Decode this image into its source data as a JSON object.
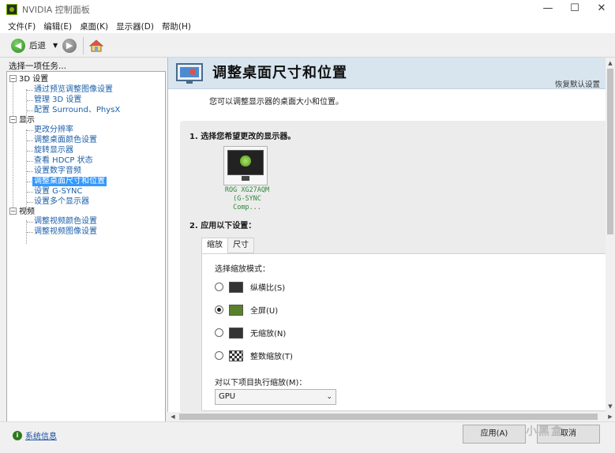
{
  "window": {
    "title": "NVIDIA 控制面板",
    "minimize": "—",
    "maximize": "☐",
    "close": "✕"
  },
  "menu": [
    "文件(F)",
    "编辑(E)",
    "桌面(K)",
    "显示器(D)",
    "帮助(H)"
  ],
  "toolbar": {
    "back_label": "后退",
    "back_glyph": "◀",
    "forward_glyph": "▶",
    "dropdown_glyph": "▼"
  },
  "sidebar": {
    "heading": "选择一项任务...",
    "categories": [
      {
        "label": "3D 设置",
        "expander": "−",
        "items": [
          "通过预览调整图像设置",
          "管理 3D 设置",
          "配置 Surround、PhysX"
        ]
      },
      {
        "label": "显示",
        "expander": "−",
        "items": [
          "更改分辨率",
          "调整桌面颜色设置",
          "旋转显示器",
          "查看 HDCP 状态",
          "设置数字音频",
          "调整桌面尺寸和位置",
          "设置 G-SYNC",
          "设置多个显示器"
        ]
      },
      {
        "label": "视频",
        "expander": "−",
        "items": [
          "调整视频颜色设置",
          "调整视频图像设置"
        ]
      }
    ],
    "selected_item": "调整桌面尺寸和位置"
  },
  "page": {
    "title": "调整桌面尺寸和位置",
    "restore_defaults": "恢复默认设置",
    "description": "您可以调整显示器的桌面大小和位置。",
    "step1": "1. 选择您希望更改的显示器。",
    "monitor_name_line1": "ROG XG27AQM",
    "monitor_name_line2": "(G-SYNC Comp...",
    "step2": "2. 应用以下设置：",
    "tabs": [
      "缩放",
      "尺寸"
    ],
    "active_tab": "缩放",
    "scaling_mode_label": "选择缩放模式：",
    "scaling_modes": [
      {
        "label": "纵横比(S)",
        "checked": false,
        "icon": "aspect-ratio-icon"
      },
      {
        "label": "全屏(U)",
        "checked": true,
        "icon": "fullscreen-icon"
      },
      {
        "label": "无缩放(N)",
        "checked": false,
        "icon": "no-scaling-icon"
      },
      {
        "label": "整数缩放(T)",
        "checked": false,
        "icon": "integer-scaling-icon"
      }
    ],
    "perform_label": "对以下项目执行缩放(M)：",
    "perform_value": "GPU"
  },
  "status": {
    "system_info": "系统信息",
    "apply": "应用(A)",
    "cancel": "取消"
  },
  "watermark": "小黑盒",
  "colors": {
    "nvidia_green": "#76b900",
    "header_bg": "#d8e5ef",
    "selection": "#3399ff"
  }
}
